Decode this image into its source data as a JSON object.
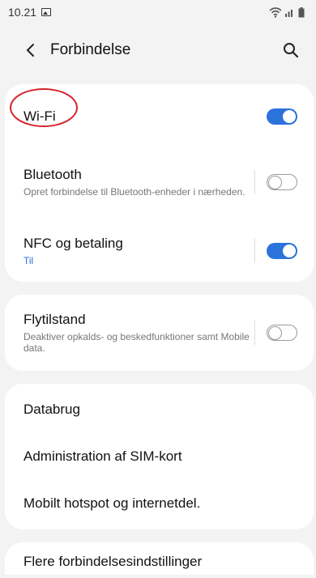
{
  "status_bar": {
    "time": "10.21"
  },
  "app_bar": {
    "title": "Forbindelse"
  },
  "connection_group": {
    "wifi": {
      "title": "Wi-Fi",
      "enabled": true
    },
    "bluetooth": {
      "title": "Bluetooth",
      "subtitle": "Opret forbindelse til Bluetooth-enheder i nærheden.",
      "enabled": false
    },
    "nfc": {
      "title": "NFC og betaling",
      "subtitle": "Til",
      "enabled": true
    }
  },
  "airplane_group": {
    "airplane": {
      "title": "Flytilstand",
      "subtitle": "Deaktiver opkalds- og beskedfunktioner samt Mobile data.",
      "enabled": false
    }
  },
  "data_group": {
    "items": [
      {
        "title": "Databrug"
      },
      {
        "title": "Administration af SIM-kort"
      },
      {
        "title": "Mobilt hotspot og internetdel."
      }
    ]
  },
  "more_group": {
    "title": "Flere forbindelsesindstillinger"
  },
  "colors": {
    "accent": "#2b72db",
    "annotation": "#d5222a",
    "background": "#f3f3f3"
  }
}
